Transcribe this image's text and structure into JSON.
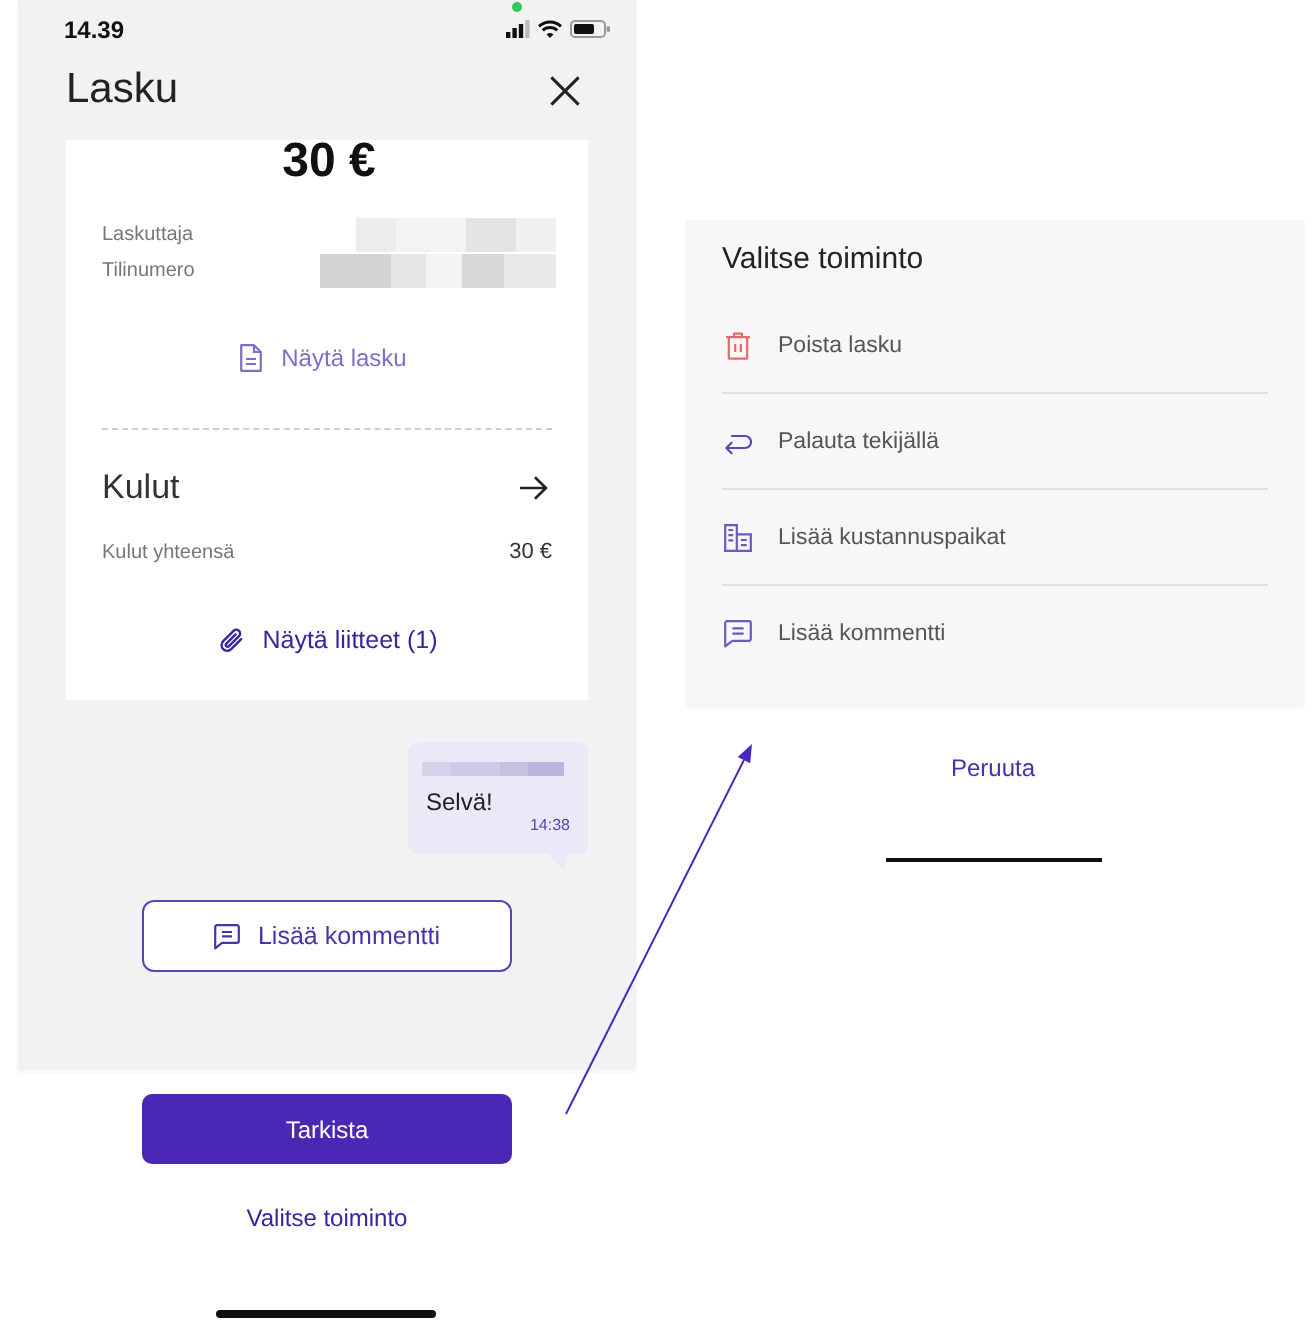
{
  "status_bar": {
    "time": "14.39"
  },
  "invoice_screen": {
    "title": "Lasku",
    "amount": "30 €",
    "details": [
      {
        "label": "Laskuttaja"
      },
      {
        "label": "Tilinumero"
      }
    ],
    "show_invoice_link": "Näytä lasku",
    "expenses": {
      "title": "Kulut",
      "total_label": "Kulut yhteensä",
      "total_value": "30 €"
    },
    "attachments_link": "Näytä liitteet (1)",
    "comment": {
      "text": "Selvä!",
      "time": "14:38"
    },
    "add_comment_button": "Lisää kommentti",
    "primary_button": "Tarkista",
    "secondary_link": "Valitse toiminto"
  },
  "action_sheet": {
    "title": "Valitse toiminto",
    "actions": [
      {
        "label": "Poista lasku",
        "kind": "delete"
      },
      {
        "label": "Palauta tekijällä",
        "kind": "return"
      },
      {
        "label": "Lisää kustannuspaikat",
        "kind": "cost_centers"
      },
      {
        "label": "Lisää kommentti",
        "kind": "comment"
      }
    ],
    "cancel": "Peruuta"
  }
}
